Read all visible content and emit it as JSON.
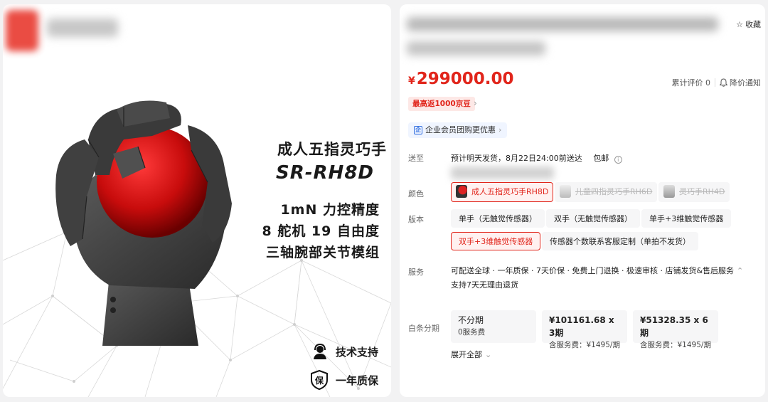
{
  "product_image": {
    "title": "成人五指灵巧手",
    "model": "SR-RH8D",
    "features": [
      "1mN 力控精度",
      "8 舵机 19 自由度",
      "三轴腕部关节模组"
    ],
    "badges": [
      {
        "icon": "headset-icon",
        "label": "技术支持"
      },
      {
        "icon": "shield-bao-icon",
        "label": "一年质保",
        "icon_text": "保"
      }
    ]
  },
  "product": {
    "favorite_label": "收藏",
    "price_currency": "¥",
    "price": "299000.00",
    "review_label": "累计评价 0",
    "price_alert_label": "降价通知",
    "jd_bean_tag": "最高返1000京豆",
    "enterprise_tag": "企业会员团购更优惠",
    "enterprise_icon_text": "企"
  },
  "delivery": {
    "label": "送至",
    "text": "预计明天发货，8月22日24:00前送达",
    "free_shipping": "包邮",
    "info_icon_text": "i"
  },
  "color": {
    "label": "颜色",
    "options": [
      {
        "label": "成人五指灵巧手RH8D",
        "state": "selected"
      },
      {
        "label": "儿童四指灵巧手RH6D",
        "state": "unavailable"
      },
      {
        "label": "灵巧手RH4D",
        "state": "unavailable"
      }
    ]
  },
  "version": {
    "label": "版本",
    "options": [
      {
        "label": "单手（无触觉传感器）",
        "state": "normal"
      },
      {
        "label": "双手（无触觉传感器）",
        "state": "normal"
      },
      {
        "label": "单手+3维触觉传感器",
        "state": "normal"
      },
      {
        "label": "双手+3维触觉传感器",
        "state": "selected"
      },
      {
        "label": "传感器个数联系客服定制（单拍不发货）",
        "state": "normal"
      }
    ]
  },
  "service": {
    "label": "服务",
    "line1": "可配送全球 · 一年质保 · 7天价保 · 免费上门退换 · 极速审核 · 店铺发货&售后服务",
    "line2": "支持7天无理由退货",
    "collapse_icon": "chevron-up-icon"
  },
  "installment": {
    "label": "白条分期",
    "options": [
      {
        "line1": "不分期",
        "line2": "0服务费"
      },
      {
        "line1": "¥101161.68 x 3期",
        "line2": "含服务费：¥1495/期"
      },
      {
        "line1": "¥51328.35 x 6期",
        "line2": "含服务费：¥1495/期"
      }
    ],
    "expand_all_label": "展开全部"
  },
  "colors": {
    "price_red": "#e1251b",
    "selected_bg": "#fff1f0",
    "option_bg": "#f6f6f7",
    "ball_red": "#d01010",
    "hand_gray": "#3d3d3d"
  }
}
